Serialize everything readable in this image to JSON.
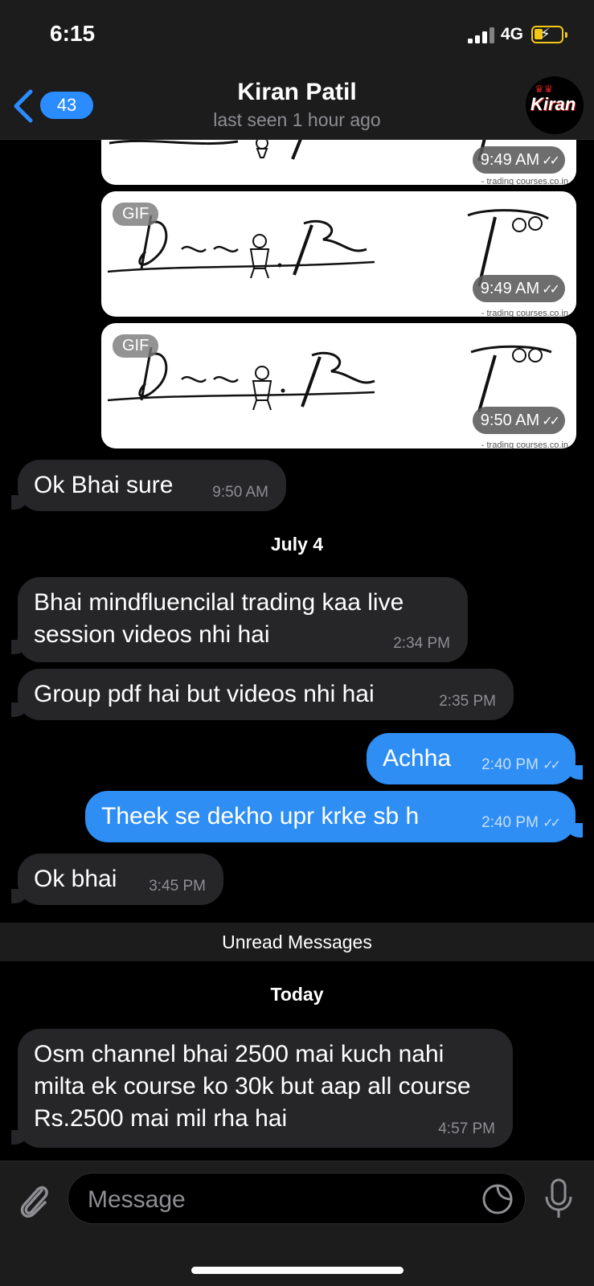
{
  "status_bar": {
    "time": "6:15",
    "network": "4G"
  },
  "header": {
    "back_count": "43",
    "contact_name": "Kiran Patil",
    "contact_status": "last seen 1 hour ago",
    "avatar_text": "Kiran"
  },
  "gifs": [
    {
      "badge": "",
      "time": "9:49 AM",
      "caption": "- trading courses.co.in"
    },
    {
      "badge": "GIF",
      "time": "9:49 AM",
      "caption": "- trading courses.co.in"
    },
    {
      "badge": "GIF",
      "time": "9:50 AM",
      "caption": "- trading courses.co.in"
    }
  ],
  "messages": [
    {
      "text": "Ok Bhai sure",
      "time": "9:50 AM",
      "direction": "in"
    },
    {
      "text": "Bhai mindfluencilal trading kaa live session videos nhi hai",
      "time": "2:34 PM",
      "direction": "in"
    },
    {
      "text": "Group pdf hai but videos nhi hai",
      "time": "2:35 PM",
      "direction": "in"
    },
    {
      "text": "Achha",
      "time": "2:40 PM",
      "direction": "out"
    },
    {
      "text": "Theek se dekho upr krke sb h",
      "time": "2:40 PM",
      "direction": "out"
    },
    {
      "text": "Ok bhai",
      "time": "3:45 PM",
      "direction": "in"
    },
    {
      "text": "Osm channel bhai 2500 mai kuch nahi milta ek course ko 30k but aap all course Rs.2500 mai mil rha hai",
      "time": "4:57 PM",
      "direction": "in"
    }
  ],
  "date_separators": {
    "july4": "July 4",
    "today": "Today"
  },
  "unread_label": "Unread Messages",
  "input": {
    "placeholder": "Message"
  },
  "colors": {
    "outgoing_bubble": "#2f8ef4",
    "incoming_bubble": "#262628",
    "accent": "#2a8cff",
    "battery": "#f5c816"
  }
}
